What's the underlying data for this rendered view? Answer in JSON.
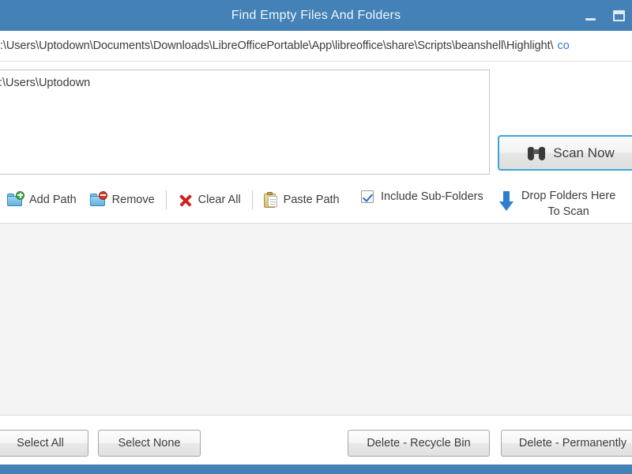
{
  "window": {
    "title": "Find Empty Files And Folders",
    "titlebar_color": "#4381b6",
    "minimize_label": "Minimize",
    "maximize_label": "Maximize"
  },
  "pathbar": {
    "text": ":\\Users\\Uptodown\\Documents\\Downloads\\LibreOfficePortable\\App\\libreoffice\\share\\Scripts\\beanshell\\Highlight\\",
    "link_text": "co",
    "link_color": "#3b7cc4"
  },
  "paths_list": {
    "items": [
      ":\\Users\\Uptodown"
    ]
  },
  "scan": {
    "button_label": "Scan Now",
    "icon": "binoculars-icon",
    "focus_color": "#39a5dc"
  },
  "dropzone": {
    "line1": "Drop Folders Here",
    "line2": "To Scan",
    "icon": "down-arrow-icon",
    "arrow_color": "#2f7fd0"
  },
  "toolbar": {
    "items": [
      {
        "label": "Add Path",
        "icon": "folder-add-icon"
      },
      {
        "label": "Remove",
        "icon": "folder-remove-icon"
      },
      {
        "label": "Clear All",
        "icon": "red-x-icon"
      },
      {
        "label": "Paste Path",
        "icon": "clipboard-icon"
      }
    ]
  },
  "options": {
    "include_subfolders_label": "Include Sub-Folders",
    "include_subfolders_checked": true
  },
  "results": {
    "rows": []
  },
  "bottom": {
    "select_all": "Select All",
    "select_none": "Select None",
    "delete_recycle": "Delete - Recycle Bin",
    "delete_permanently": "Delete - Permanently"
  }
}
